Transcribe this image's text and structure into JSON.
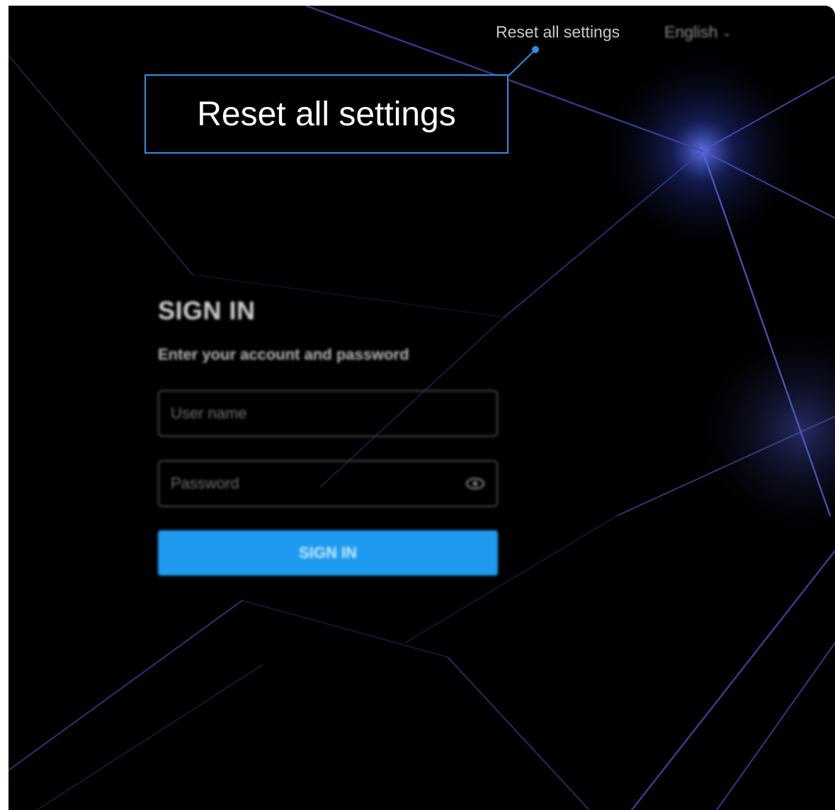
{
  "topbar": {
    "reset_label": "Reset all settings",
    "language_label": "English",
    "language_chevron_icon": "chevron-down-icon"
  },
  "callout": {
    "text": "Reset all settings",
    "border_color": "#2f8de4"
  },
  "signin": {
    "title": "SIGN IN",
    "subtitle": "Enter your account and password",
    "username_placeholder": "User name",
    "password_placeholder": "Password",
    "password_toggle_icon": "eye-icon",
    "button_label": "SIGN IN",
    "button_color": "#1e9bf0"
  }
}
